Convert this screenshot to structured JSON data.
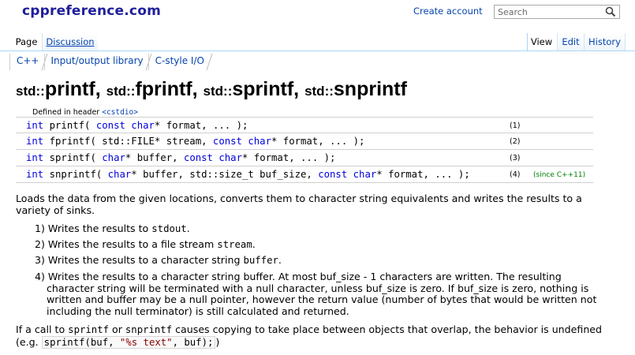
{
  "site": {
    "title": "cppreference.com",
    "create_account": "Create account",
    "search_placeholder": "Search"
  },
  "tabs": {
    "page": "Page",
    "discussion": "Discussion",
    "view": "View",
    "edit": "Edit",
    "history": "History"
  },
  "breadcrumb": [
    "C++",
    "Input/output library",
    "C-style I/O"
  ],
  "title": {
    "ns": "std::",
    "f1": "printf",
    "sep": ", ",
    "f2": "fprintf",
    "f3": "sprintf",
    "f4": "snprintf"
  },
  "header_note": {
    "text": "Defined in header ",
    "header": "<cstdio>"
  },
  "declarations": [
    {
      "num": "(1)",
      "since": ""
    },
    {
      "num": "(2)",
      "since": ""
    },
    {
      "num": "(3)",
      "since": ""
    },
    {
      "num": "(4)",
      "since": "(since C++11)"
    }
  ],
  "intro": "Loads the data from the given locations, converts them to character string equivalents and writes the results to a variety of sinks.",
  "items": {
    "i1_prefix": "1) Writes the results to ",
    "i1_code": "stdout",
    "i1_suffix": ".",
    "i2_prefix": "2) Writes the results to a file stream ",
    "i2_code": "stream",
    "i2_suffix": ".",
    "i3_prefix": "3) Writes the results to a character string ",
    "i3_code": "buffer",
    "i3_suffix": ".",
    "i4_line1": "4) Writes the results to a character string buffer. At most buf_size - 1 characters are written. The resulting",
    "i4_line2": "character string will be terminated with a null character, unless buf_size is zero. If buf_size is zero, nothing is",
    "i4_line3": "written and buffer may be a null pointer, however the return value (number of bytes that would be written not",
    "i4_line4": "including the null terminator) is still calculated and returned."
  },
  "outro": {
    "a": "If a call to ",
    "b": "sprintf",
    "c": " or ",
    "d": "snprintf",
    "e": " causes copying to take place between objects that overlap, the behavior is undefined",
    "f": "(e.g. ",
    "g_fn": "sprintf(buf, ",
    "g_str": "\"%s text\"",
    "g_end": ", buf);",
    "h": ")"
  }
}
